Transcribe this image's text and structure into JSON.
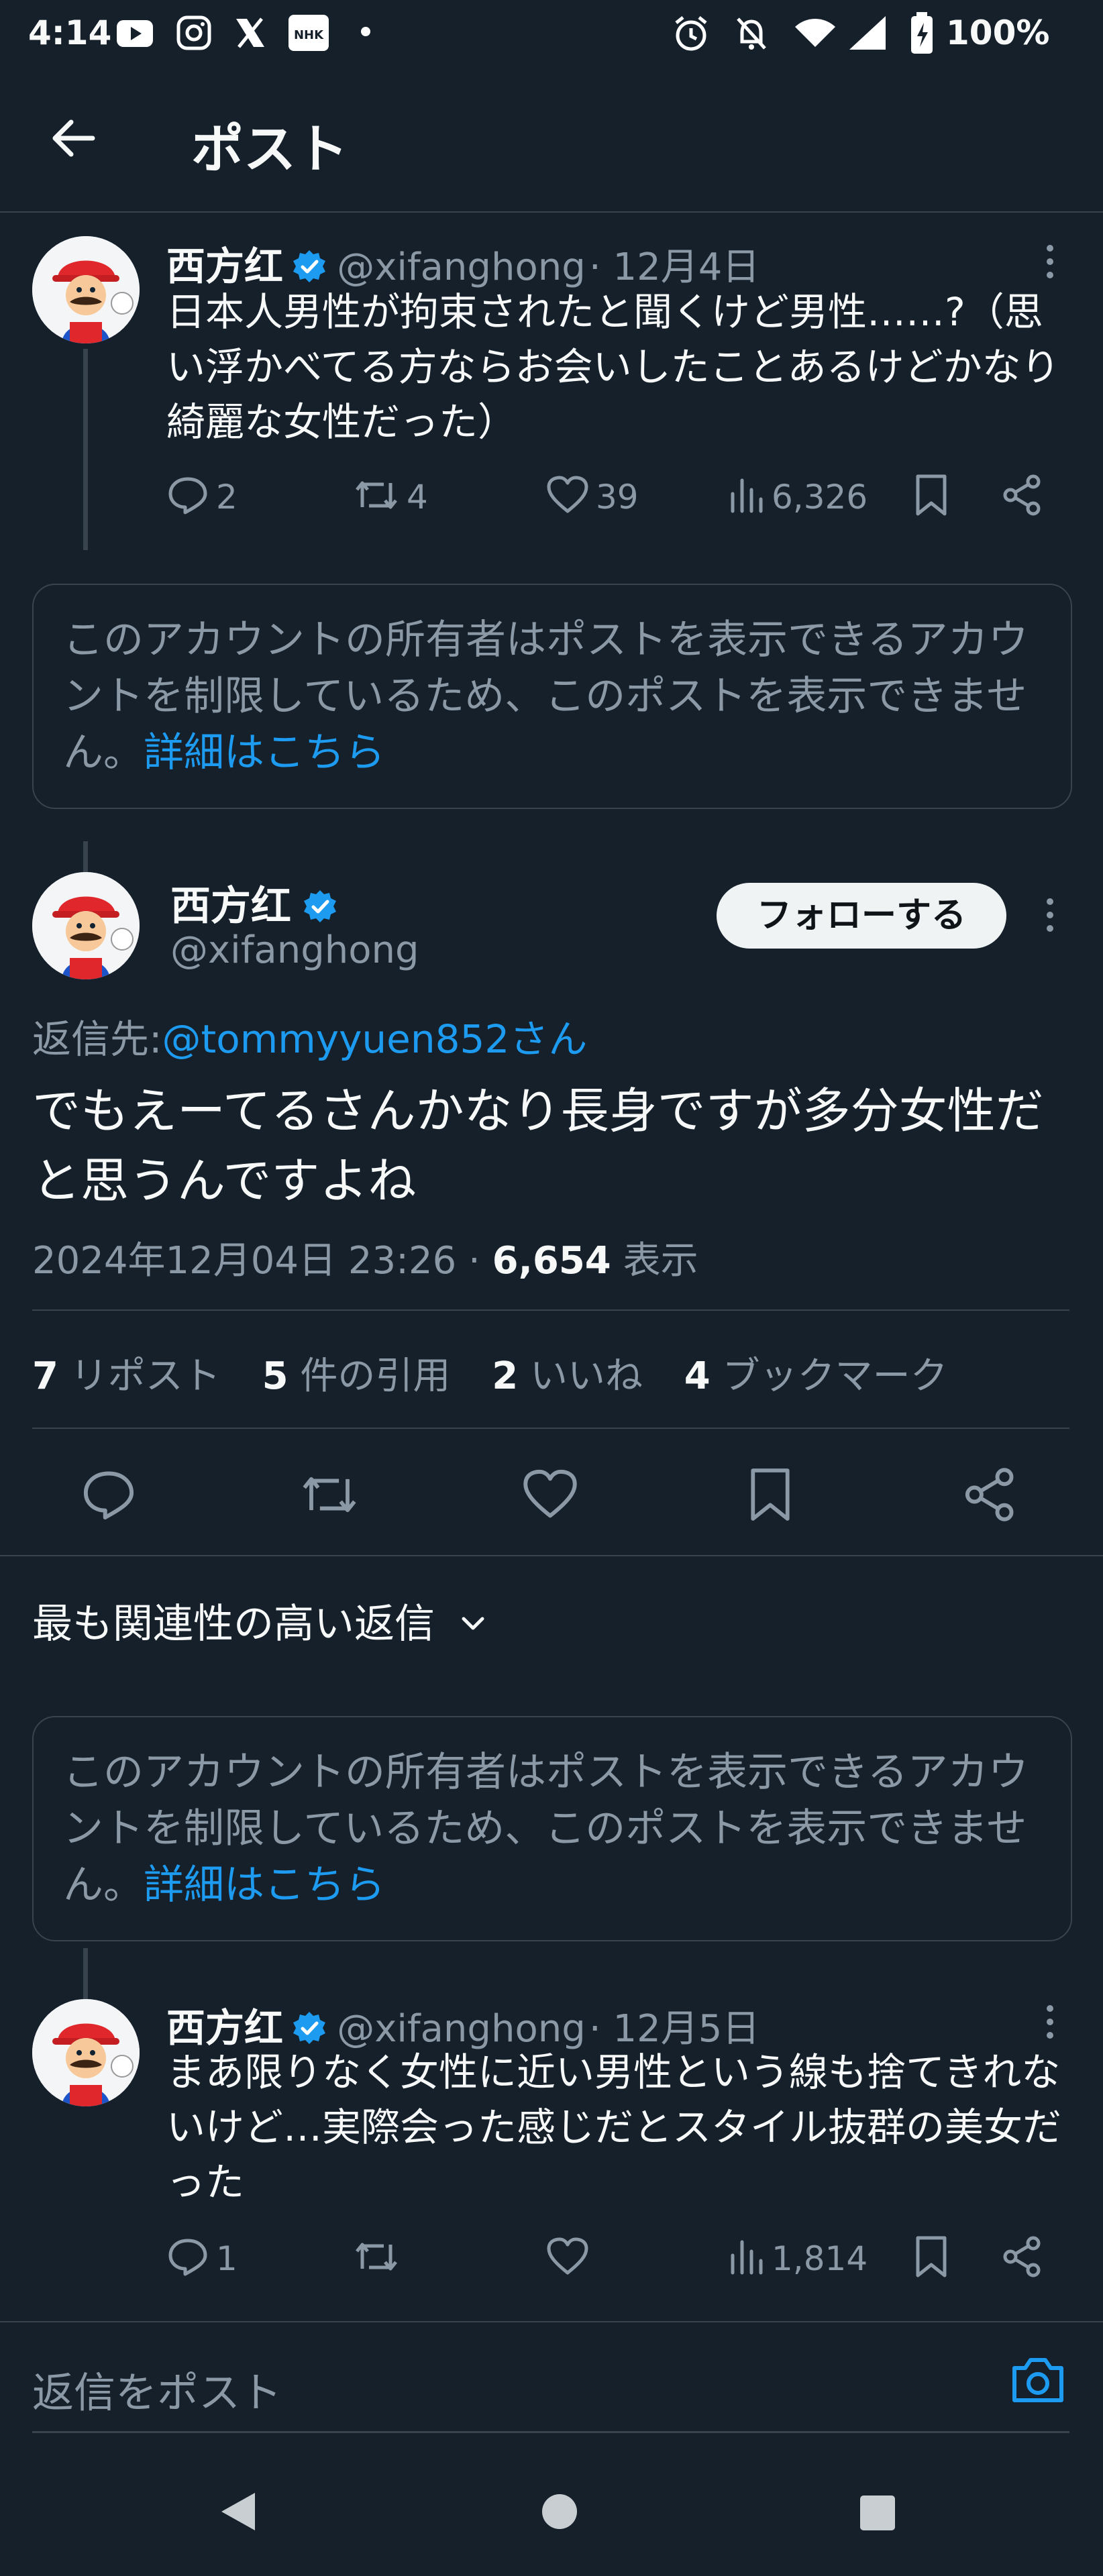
{
  "status_bar": {
    "time": "4:14",
    "battery": "100%"
  },
  "header": {
    "title": "ポスト"
  },
  "post1": {
    "name": "西方红",
    "handle": "@xifanghong",
    "date": "· 12月4日",
    "text": "日本人男性が拘束されたと聞くけど男性……?（思い浮かべてる方ならお会いしたことあるけどかなり綺麗な女性だった）",
    "replies": "2",
    "reposts": "4",
    "likes": "39",
    "views": "6,326"
  },
  "notice": {
    "text": "このアカウントの所有者はポストを表示できるアカウントを制限しているため、このポストを表示できません。",
    "link": "詳細はこちら"
  },
  "main_post": {
    "name": "西方红",
    "handle": "@xifanghong",
    "follow_label": "フォローする",
    "reply_to_prefix": "返信先:",
    "reply_to_user": "@tommyyuen852さん",
    "text": "でもえーてるさんかなり長身ですが多分女性だと思うんですよね",
    "timestamp": "2024年12月04日 23:26 ·",
    "views_count": "6,654",
    "views_label": "表示",
    "stats": [
      {
        "count": "7",
        "label": "リポスト"
      },
      {
        "count": "5",
        "label": "件の引用"
      },
      {
        "count": "2",
        "label": "いいね"
      },
      {
        "count": "4",
        "label": "ブックマーク"
      }
    ]
  },
  "replies_sort": {
    "label": "最も関連性の高い返信"
  },
  "notice2": {
    "text": "このアカウントの所有者はポストを表示できるアカウントを制限しているため、このポストを表示できません。",
    "link": "詳細はこちら"
  },
  "post3": {
    "name": "西方红",
    "handle": "@xifanghong",
    "date": "· 12月5日",
    "text": "まあ限りなく女性に近い男性という線も捨てきれないけど…実際会った感じだとスタイル抜群の美女だった",
    "replies": "1",
    "reposts": "",
    "likes": "",
    "views": "1,814"
  },
  "reply_bar": {
    "placeholder": "返信をポスト"
  },
  "colors": {
    "background": "#15202b",
    "accent": "#1d9bf0",
    "text": "#f7f9f9",
    "muted": "#8b98a5",
    "border": "#38444d"
  }
}
